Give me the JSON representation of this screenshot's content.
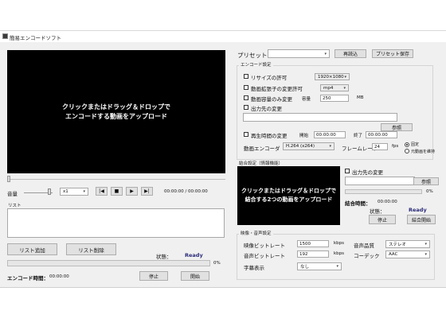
{
  "window": {
    "title": "簡易エンコードソフト"
  },
  "left": {
    "drop_text_1": "クリックまたはドラッグ＆ドロップで",
    "drop_text_2": "エンコードする動画をアップロード",
    "volume_label": "音量",
    "speed_value": "x1",
    "prev_icon": "|◀",
    "stop_icon": "■",
    "play_icon": "▶",
    "next_icon": "▶|",
    "time_display": "00:00:00 / 00:00:00",
    "list_label": "リスト",
    "add_list": "リスト追加",
    "remove_list": "リスト削除",
    "status_label": "状態：",
    "status_value": "Ready",
    "progress_percent": "0%",
    "progress_fraction": 0,
    "encode_time_label": "エンコード時間：",
    "encode_time_value": "00:00:00",
    "stop_button": "停止",
    "start_button": "開始"
  },
  "right": {
    "preset_label": "プリセット",
    "preset_value": "",
    "preset_load": "再読込",
    "preset_save": "プリセット保存",
    "encode_settings_title": "エンコード設定",
    "resize_label": "リサイズの許可",
    "resize_value": "1920×1080",
    "ext_change_label": "動画拡張子の変更許可",
    "ext_value": "mp4",
    "size_only_label": "動画容量のみ変更",
    "capacity_label": "容量",
    "capacity_value": "250",
    "capacity_unit": "MB",
    "output_change_label": "出力先の変更",
    "output_path": "",
    "browse_1": "参照",
    "playtime_label": "再生時間の変更",
    "start_label": "開始",
    "start_value": "00:00:00",
    "end_label": "終了",
    "end_value": "00:00:00",
    "encoder_label": "動画エンコーダ",
    "encoder_value": "H.264 (x264)",
    "framerate_label": "フレームレート",
    "framerate_value": "24",
    "fps_unit": "fps",
    "radio_fixed": "固定",
    "radio_variable": "元動画を維持",
    "merge_title": "結合設定（情報機能）",
    "merge_drop_1": "クリックまたはドラッグ＆ドロップで",
    "merge_drop_2": "結合する2つの動画をアップロード",
    "merge_output_label": "出力先の変更",
    "merge_path": "",
    "browse_2": "参照",
    "merge_percent": "0%",
    "merge_progress_fraction": 0,
    "merge_time_label": "結合時間：",
    "merge_time_value": "00:00:00",
    "merge_status_label": "状態：",
    "merge_status_value": "Ready",
    "merge_stop": "停止",
    "merge_start": "結合開始",
    "av_title": "映像・音声設定",
    "video_bitrate_label": "映像ビットレート",
    "video_bitrate_value": "1500",
    "kbps_1": "kbps",
    "audio_bitrate_label": "音声ビットレート",
    "audio_bitrate_value": "192",
    "kbps_2": "kbps",
    "subtitle_label": "字幕表示",
    "subtitle_value": "なし",
    "audio_quality_label": "音声品質",
    "audio_quality_value": "ステレオ",
    "codec_label": "コーデック",
    "codec_value": "AAC"
  }
}
